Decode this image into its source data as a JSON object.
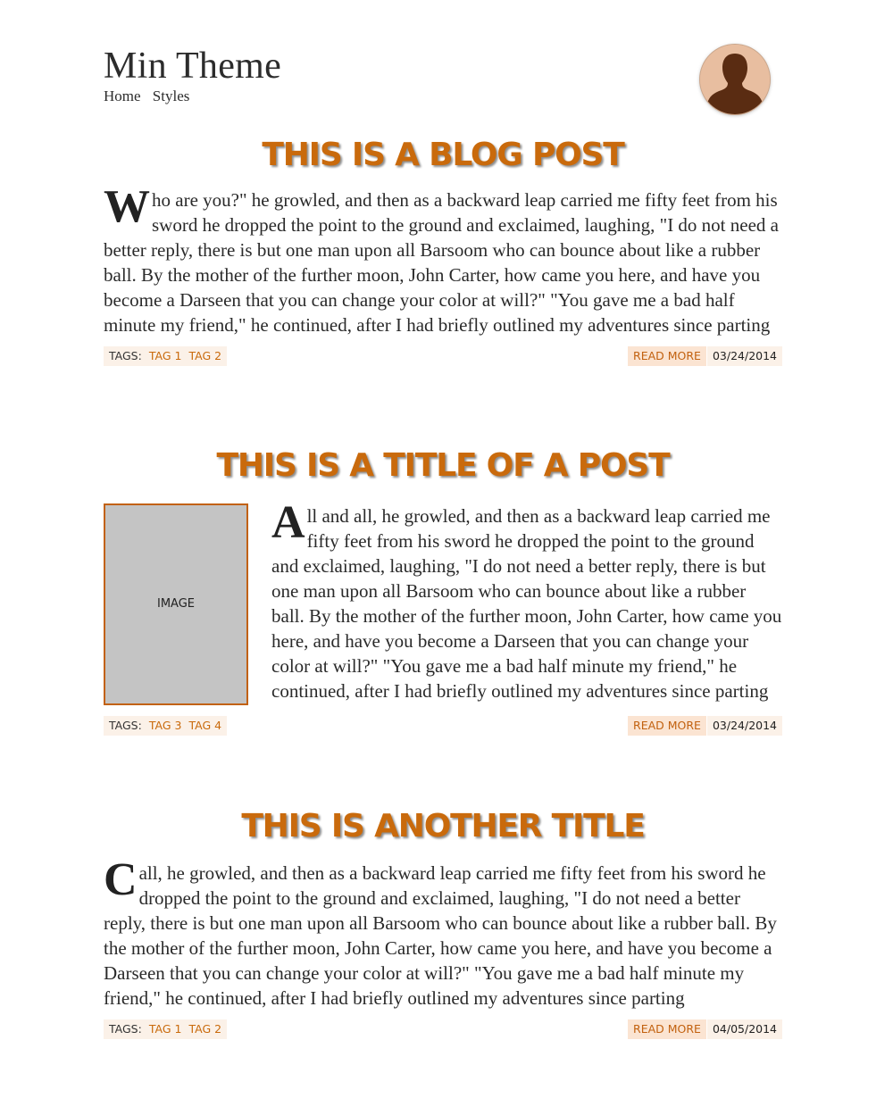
{
  "site": {
    "title": "Min Theme",
    "nav": [
      "Home",
      "Styles"
    ],
    "accent_color": "#c96a0c",
    "avatar_icon": "user-silhouette-icon"
  },
  "posts": [
    {
      "title": "THIS IS A BLOG POST",
      "dropcap": "W",
      "body": "ho are you?\" he growled, and then as a backward leap carried me fifty feet from his sword he dropped the point to the ground and exclaimed, laughing, \"I do not need a better reply, there is but one man upon all Barsoom who can bounce about like a rubber ball. By the mother of the further moon, John Carter, how came you here, and have you become a Darseen that you can change your color at will?\" \"You gave me a bad half minute my friend,\" he continued, after I had briefly outlined my adventures since parting",
      "tags_label": "TAGS:",
      "tags": [
        "TAG 1",
        "TAG 2"
      ],
      "read_more": "READ MORE",
      "date": "03/24/2014"
    },
    {
      "title": "THIS IS A TITLE OF A POST",
      "image_label": "IMAGE",
      "dropcap": "A",
      "body": "ll and all, he growled, and then as a backward leap carried me fifty feet from his sword he dropped the point to the ground and exclaimed, laughing, \"I do not need a better reply, there is but one man upon all Barsoom who can bounce about like a rubber ball. By the mother of the further moon, John Carter, how came you here, and have you become a Darseen that you can change your color at will?\" \"You gave me a bad half minute my friend,\" he continued, after I had briefly outlined my adventures since parting",
      "tags_label": "TAGS:",
      "tags": [
        "TAG 3",
        "TAG 4"
      ],
      "read_more": "READ MORE",
      "date": "03/24/2014"
    },
    {
      "title": "THIS IS ANOTHER TITLE",
      "dropcap": "C",
      "body": "all, he growled, and then as a backward leap carried me fifty feet from his sword he dropped the point to the ground and exclaimed, laughing, \"I do not need a better reply, there is but one man upon all Barsoom who can bounce about like a rubber ball. By the mother of the further moon, John Carter, how came you here, and have you become a Darseen that you can change your color at will?\" \"You gave me a bad half minute my friend,\" he continued, after I had briefly outlined my adventures since parting",
      "tags_label": "TAGS:",
      "tags": [
        "TAG 1",
        "TAG 2"
      ],
      "read_more": "READ MORE",
      "date": "04/05/2014"
    }
  ]
}
